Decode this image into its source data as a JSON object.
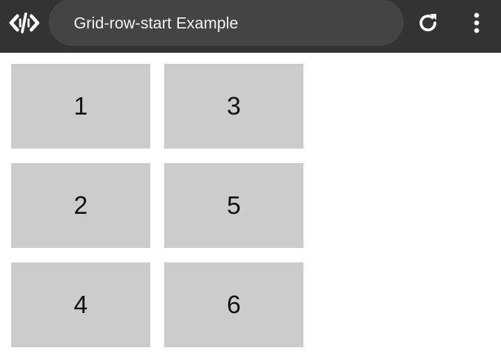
{
  "toolbar": {
    "title": "Grid-row-start Example",
    "app_icon": "code-slash-icon",
    "reload_icon": "reload-icon",
    "menu_icon": "more-vertical-icon",
    "background": "#333333",
    "pill_background": "#444444"
  },
  "grid": {
    "items": [
      "1",
      "3",
      "2",
      "5",
      "4",
      "6"
    ],
    "cell_color": "#cccccc"
  }
}
